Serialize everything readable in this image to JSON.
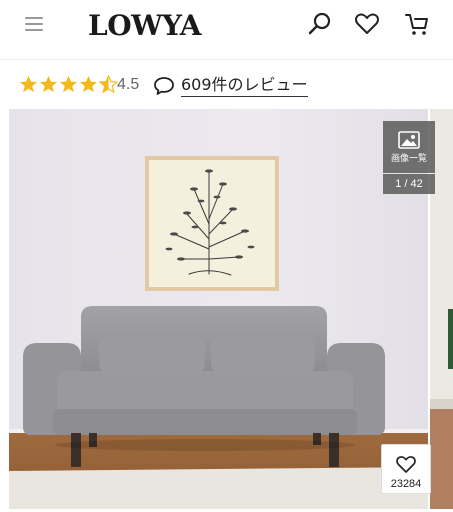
{
  "header": {
    "logo": "LOWYA",
    "icons": [
      "menu-icon",
      "search-icon",
      "heart-icon",
      "cart-icon"
    ]
  },
  "rating": {
    "stars": 4.5,
    "value": "4.5",
    "review_link": "609件のレビュー",
    "star_color": "#f3b81a"
  },
  "gallery": {
    "button_label": "画像一覧",
    "counter": "1 / 42",
    "favorite_count": "23284"
  }
}
